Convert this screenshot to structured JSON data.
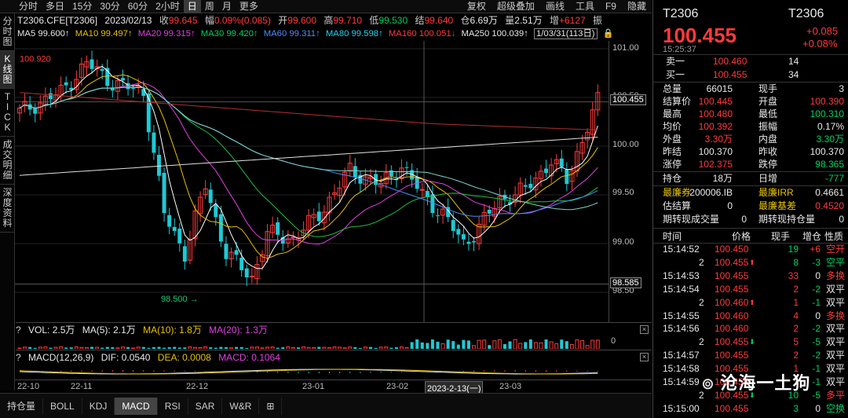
{
  "toolbar": {
    "items": [
      "分时",
      "多日",
      "15分",
      "30分",
      "60分",
      "2小时",
      "日",
      "周",
      "月",
      "更多"
    ],
    "active": "日",
    "right": [
      "复权",
      "超级叠加",
      "画线",
      "工具",
      "F9",
      "隐藏"
    ]
  },
  "sidetabs": [
    "分时图",
    "K线图",
    "TICK",
    "成交明细",
    "深度资料"
  ],
  "info1": {
    "code": "T2306.CFE[T2306]",
    "date": "2023/02/13",
    "shou_label": "收",
    "shou": "99.645",
    "fu_label": "幅",
    "fu": "0.09%(0.085)",
    "kai_label": "开",
    "kai": "99.600",
    "gao_label": "高",
    "gao": "99.710",
    "di_label": "低",
    "di": "99.530",
    "jie_label": "结",
    "jie": "99.640",
    "cang_label": "仓",
    "cang": "6.69万",
    "liang_label": "量",
    "liang": "2.51万",
    "zeng_label": "增",
    "zeng": "+6127",
    "zhen_label": "振"
  },
  "info2": {
    "ma5": "MA5 99.600↑",
    "ma10": "MA10 99.497↑",
    "ma20": "MA20 99.315↑",
    "ma30": "MA30 99.420↑",
    "ma60": "MA60 99.311↑",
    "ma80": "MA80 99.598↑",
    "ma160": "MA160 100.051↓",
    "ma250": "MA250 100.039↑",
    "range": "1/03/31(113日)"
  },
  "axis": {
    "y": [
      "101.00",
      "100.50",
      "100.00",
      "99.50",
      "99.00",
      "98.50"
    ],
    "price_box": "100.455",
    "low_box": "98.585",
    "hi_mark": "100.920",
    "lo_mark": "98.500"
  },
  "xaxis": {
    "labels": [
      "22-10",
      "22-11",
      "22-12",
      "23-01",
      "23-02",
      "23-03"
    ],
    "cursor": "2023-2-13(一)"
  },
  "vol": {
    "q": "?",
    "vol": "VOL: 2.5万",
    "ma5": "MA(5): 2.1万",
    "ma10": "MA(10): 1.8万",
    "ma20": "MA(20): 1.3万",
    "zero": "0",
    "x": "×"
  },
  "macd": {
    "q": "?",
    "name": "MACD(12,26,9)",
    "dif": "DIF: 0.0540",
    "dea": "DEA: 0.0008",
    "macd": "MACD: 0.1064",
    "x": "×"
  },
  "bottomtabs": {
    "items": [
      "持仓量",
      "BOLL",
      "KDJ",
      "MACD",
      "RSI",
      "SAR",
      "W&R",
      "⊞"
    ],
    "active": "MACD"
  },
  "right": {
    "code": "T2306",
    "code2": "T2306",
    "price": "100.455",
    "chg": "+0.085",
    "pct": "+0.08%",
    "time": "15:25:37",
    "sell_label": "卖一",
    "sell_price": "100.460",
    "sell_vol": "14",
    "buy_label": "买一",
    "buy_price": "100.455",
    "buy_vol": "34",
    "stats": [
      {
        "l1": "总量",
        "v1": "66015",
        "l2": "现手",
        "v2": "3"
      },
      {
        "l1": "结算价",
        "v1": "100.445",
        "l2": "开盘",
        "v2": "100.390"
      },
      {
        "l1": "最高",
        "v1": "100.480",
        "l2": "最低",
        "v2": "100.310"
      },
      {
        "l1": "均价",
        "v1": "100.392",
        "l2": "振幅",
        "v2": "0.17%"
      },
      {
        "l1": "外盘",
        "v1": "3.30万",
        "l2": "内盘",
        "v2": "3.30万"
      },
      {
        "l1": "昨结",
        "v1": "100.370",
        "l2": "昨收",
        "v2": "100.370"
      },
      {
        "l1": "涨停",
        "v1": "102.375",
        "l2": "跌停",
        "v2": "98.365"
      }
    ],
    "hold_label": "持仓",
    "hold": "18万",
    "rizeng_label": "日增",
    "rizeng": "-777",
    "cheap_label": "最廉券",
    "cheap": "200006.IB",
    "irr_label": "最廉IRR",
    "irr": "0.4661",
    "est_label": "估结算",
    "est": "0",
    "basis_label": "最廉基差",
    "basis": "0.4520",
    "tvol_label": "期转现成交量",
    "tvol": "0",
    "thold_label": "期转现持仓量",
    "thold": "0",
    "ticks_header": [
      "时间",
      "价格",
      "现手",
      "增仓",
      "性质"
    ],
    "ticks": [
      {
        "t": "15:14:52",
        "p": "100.450",
        "arr": "",
        "v": "19",
        "z": "+6",
        "n": "空开"
      },
      {
        "t": "2",
        "p": "100.455",
        "arr": "up",
        "v": "8",
        "z": "-3",
        "n": "空平"
      },
      {
        "t": "15:14:53",
        "p": "100.455",
        "arr": "",
        "v": "33",
        "z": "0",
        "n": "多换"
      },
      {
        "t": "15:14:54",
        "p": "100.455",
        "arr": "",
        "v": "2",
        "z": "-2",
        "n": "双平"
      },
      {
        "t": "2",
        "p": "100.460",
        "arr": "up",
        "v": "1",
        "z": "-1",
        "n": "双平"
      },
      {
        "t": "15:14:55",
        "p": "100.460",
        "arr": "",
        "v": "4",
        "z": "0",
        "n": "多换"
      },
      {
        "t": "15:14:56",
        "p": "100.460",
        "arr": "",
        "v": "2",
        "z": "-2",
        "n": "双平"
      },
      {
        "t": "2",
        "p": "100.455",
        "arr": "down",
        "v": "5",
        "z": "-5",
        "n": "双平"
      },
      {
        "t": "15:14:57",
        "p": "100.455",
        "arr": "",
        "v": "2",
        "z": "-2",
        "n": "双平"
      },
      {
        "t": "15:14:58",
        "p": "100.455",
        "arr": "",
        "v": "1",
        "z": "-1",
        "n": "双平"
      },
      {
        "t": "15:14:59",
        "p": "100.455",
        "arr": "",
        "v": "1",
        "z": "-1",
        "n": "双平"
      },
      {
        "t": "2",
        "p": "100.455",
        "arr": "down",
        "v": "10",
        "z": "-5",
        "n": "多平"
      },
      {
        "t": "15:15:00",
        "p": "100.455",
        "arr": "",
        "v": "3",
        "z": "0",
        "n": "空换"
      }
    ]
  },
  "watermark": "沧海一土狗",
  "colors": {
    "up": "#ff3b3b",
    "down": "#1fc9d4",
    "ma5": "#ffffff",
    "ma10": "#e6c200",
    "ma20": "#e040e0",
    "ma30": "#1fbf3f",
    "ma60": "#4a8cff",
    "ma80": "#7fd6c8",
    "ma160": "#b03030",
    "ma250": "#e0e0e0"
  }
}
